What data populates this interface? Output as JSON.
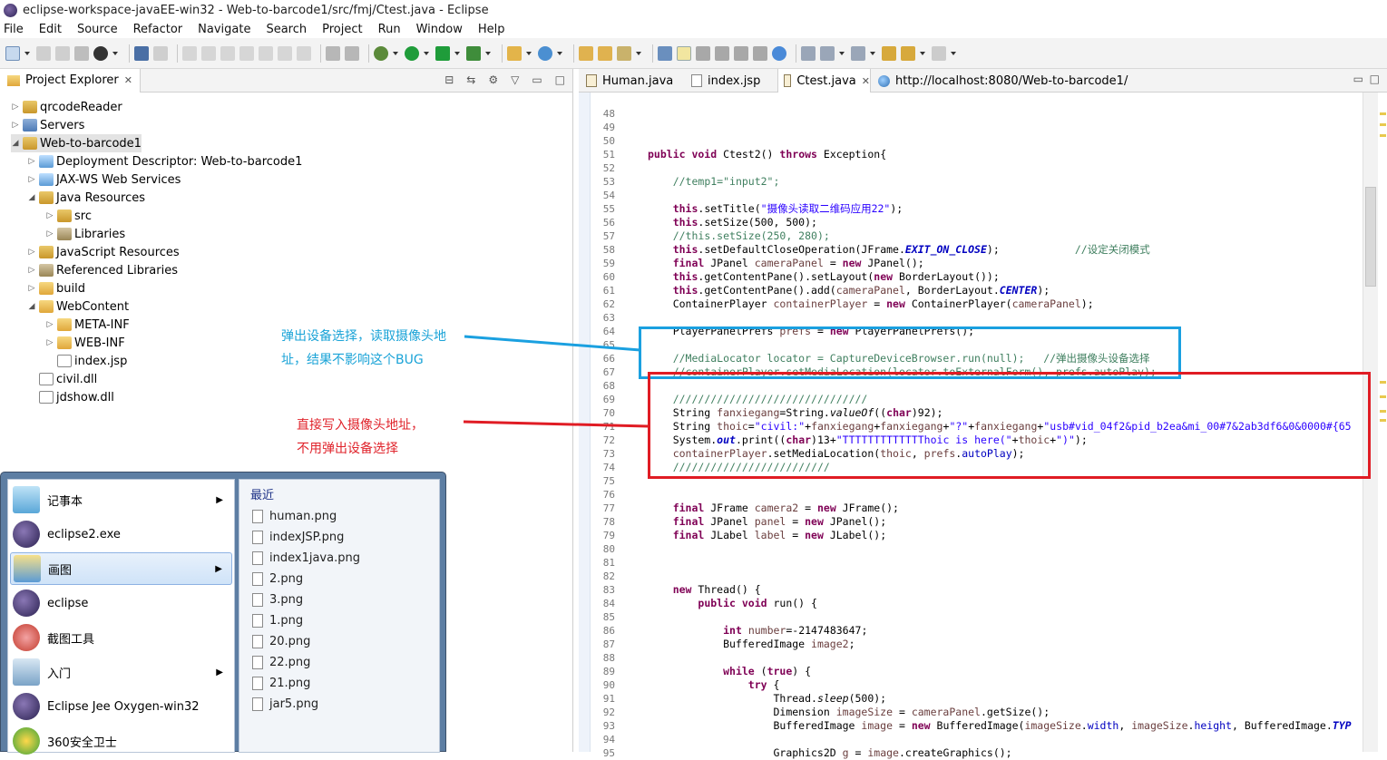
{
  "window": {
    "title": "eclipse-workspace-javaEE-win32 - Web-to-barcode1/src/fmj/Ctest.java - Eclipse"
  },
  "menu": [
    "File",
    "Edit",
    "Source",
    "Refactor",
    "Navigate",
    "Search",
    "Project",
    "Run",
    "Window",
    "Help"
  ],
  "project_explorer": {
    "tab_label": "Project Explorer",
    "tree": [
      {
        "label": "qrcodeReader",
        "icon": "project-icon",
        "level": 0,
        "expanded": false
      },
      {
        "label": "Servers",
        "icon": "server-folder-icon",
        "level": 0,
        "expanded": false
      },
      {
        "label": "Web-to-barcode1",
        "icon": "project-icon",
        "level": 0,
        "expanded": true
      },
      {
        "label": "Deployment Descriptor: Web-to-barcode1",
        "icon": "descriptor-icon",
        "level": 1,
        "expanded": false
      },
      {
        "label": "JAX-WS Web Services",
        "icon": "webservice-icon",
        "level": 1,
        "expanded": false
      },
      {
        "label": "Java Resources",
        "icon": "java-resources-icon",
        "level": 1,
        "expanded": true
      },
      {
        "label": "src",
        "icon": "package-folder-icon",
        "level": 2,
        "expanded": false
      },
      {
        "label": "Libraries",
        "icon": "library-icon",
        "level": 2,
        "expanded": false
      },
      {
        "label": "JavaScript Resources",
        "icon": "js-resources-icon",
        "level": 1,
        "expanded": false
      },
      {
        "label": "Referenced Libraries",
        "icon": "library-icon",
        "level": 1,
        "expanded": false
      },
      {
        "label": "build",
        "icon": "folder-icon",
        "level": 1,
        "expanded": false
      },
      {
        "label": "WebContent",
        "icon": "folder-icon",
        "level": 1,
        "expanded": true
      },
      {
        "label": "META-INF",
        "icon": "folder-icon",
        "level": 2,
        "expanded": false
      },
      {
        "label": "WEB-INF",
        "icon": "folder-icon",
        "level": 2,
        "expanded": false
      },
      {
        "label": "index.jsp",
        "icon": "jsp-file-icon",
        "level": 2,
        "expanded": null
      },
      {
        "label": "civil.dll",
        "icon": "file-icon",
        "level": 1,
        "expanded": null
      },
      {
        "label": "jdshow.dll",
        "icon": "file-icon",
        "level": 1,
        "expanded": null
      }
    ]
  },
  "annotations": {
    "cyan_line1": "弹出设备选择，读取摄像头地",
    "cyan_line2": "址，结果不影响这个BUG",
    "red_line1": "直接写入摄像头地址，",
    "red_line2": "不用弹出设备选择"
  },
  "start_menu": {
    "pinned": [
      {
        "label": "记事本",
        "icon": "notepad-icon",
        "submenu": true
      },
      {
        "label": "eclipse2.exe",
        "icon": "eclipse-icon",
        "submenu": false
      },
      {
        "label": "画图",
        "icon": "paint-icon",
        "submenu": true
      },
      {
        "label": "eclipse",
        "icon": "eclipse-icon",
        "submenu": false
      },
      {
        "label": "截图工具",
        "icon": "snipping-tool-icon",
        "submenu": false
      },
      {
        "label": "入门",
        "icon": "getting-started-icon",
        "submenu": true
      },
      {
        "label": "Eclipse Jee Oxygen-win32",
        "icon": "eclipse-icon",
        "submenu": false
      },
      {
        "label": "360安全卫士",
        "icon": "360-icon",
        "submenu": false
      }
    ],
    "recent_header": "最近",
    "recent": [
      "human.png",
      "indexJSP.png",
      "index1java.png",
      "2.png",
      "3.png",
      "1.png",
      "20.png",
      "22.png",
      "21.png",
      "jar5.png"
    ]
  },
  "editor": {
    "tabs": [
      "Human.java",
      "index.jsp",
      "Ctest.java",
      "http://localhost:8080/Web-to-barcode1/"
    ],
    "active_tab": "Ctest.java",
    "line_numbers": [
      "48",
      "49",
      "50",
      "51",
      "52",
      "53",
      "54",
      "55",
      "56",
      "57",
      "58",
      "59",
      "60",
      "61",
      "62",
      "63",
      "64",
      "65",
      "66",
      "67",
      "68",
      "69",
      "70",
      "71",
      "72",
      "73",
      "74",
      "75",
      "76",
      "77",
      "78",
      "79",
      "80",
      "81",
      "82",
      "83",
      "84",
      "85",
      "86",
      "87",
      "88",
      "89",
      "90",
      "91",
      "92",
      "93",
      "94",
      "95"
    ]
  }
}
